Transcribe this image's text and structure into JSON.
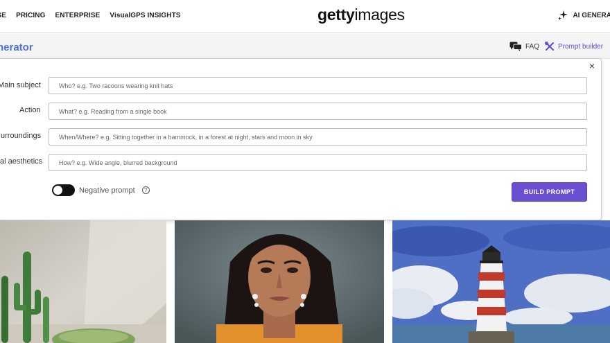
{
  "nav": {
    "links": [
      "WSE",
      "PRICING",
      "ENTERPRISE",
      "VisualGPS INSIGHTS"
    ],
    "logo_bold": "getty",
    "logo_light": "images",
    "ai_generator": "AI GENERA"
  },
  "subheader": {
    "title": "nerator",
    "faq": "FAQ",
    "prompt_builder": "Prompt builder"
  },
  "form": {
    "rows": [
      {
        "label": "Main subject",
        "placeholder": "Who? e.g. Two racoons wearing knit hats"
      },
      {
        "label": "Action",
        "placeholder": "What? e.g. Reading from a single book"
      },
      {
        "label": "urroundings",
        "placeholder": "When/Where? e.g. Sitting together in a hammock, in a forest at night, stars and moon in sky"
      },
      {
        "label": "al aesthetics",
        "placeholder": "How? e.g. Wide angle, blurred background"
      }
    ],
    "negative_prompt": "Negative prompt",
    "negative_prompt_enabled": false,
    "help_glyph": "?",
    "build_button": "BUILD PROMPT",
    "close_glyph": "×"
  },
  "images": [
    {
      "subject": "cactus-plants"
    },
    {
      "subject": "woman-portrait"
    },
    {
      "subject": "lighthouse-painting"
    }
  ],
  "colors": {
    "accent": "#6a4fd3",
    "title_blue": "#4f6fd9"
  }
}
